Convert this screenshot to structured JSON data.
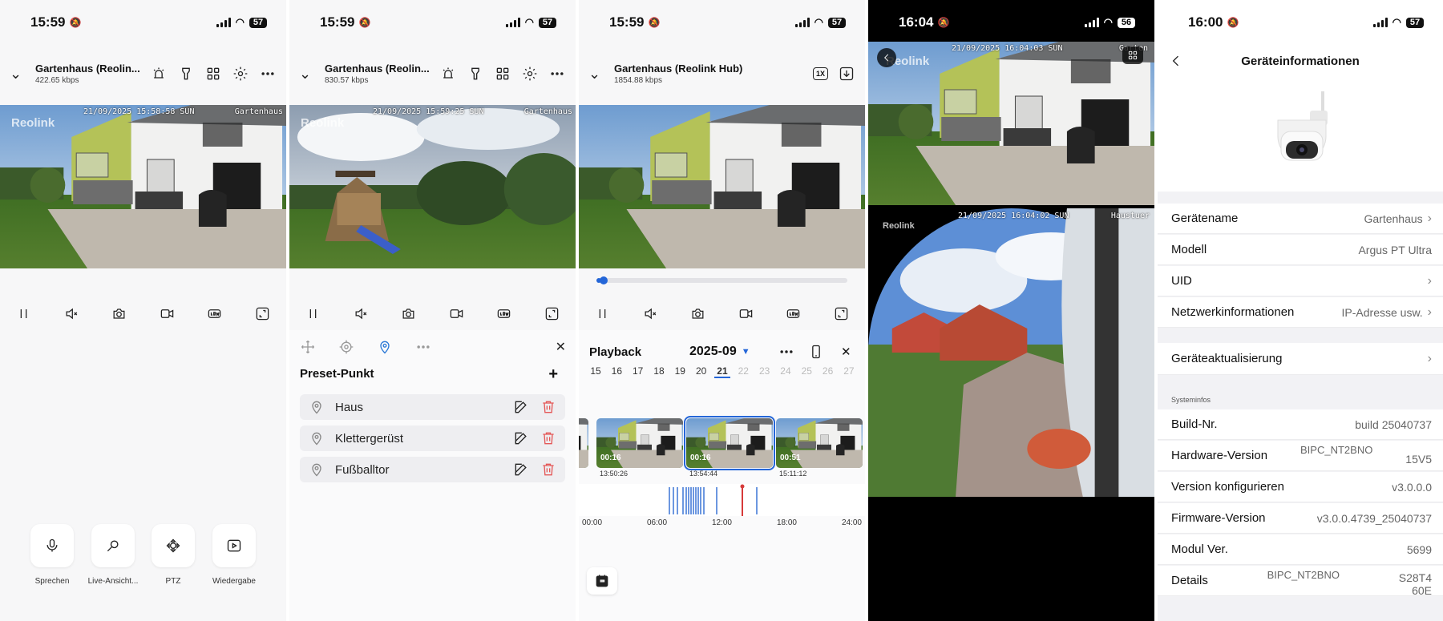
{
  "panels": [
    {
      "status": {
        "time": "15:59",
        "battery": "57"
      },
      "header": {
        "title": "Gartenhaus (Reolin...",
        "bitrate": "422.65 kbps"
      },
      "video": {
        "osd_time": "21/09/2025 15:58:58 SUN",
        "osd_name": "Gartenhaus",
        "logo": "Reolink"
      },
      "tools": [
        "Sprechen",
        "Live-Ansicht...",
        "PTZ",
        "Wiedergabe"
      ]
    },
    {
      "status": {
        "time": "15:59",
        "battery": "57"
      },
      "header": {
        "title": "Gartenhaus (Reolin...",
        "bitrate": "830.57 kbps"
      },
      "video": {
        "osd_time": "21/09/2025 15:59:25 SUN",
        "osd_name": "Gartenhaus",
        "logo": "Reolink"
      },
      "preset_title": "Preset-Punkt",
      "presets": [
        "Haus",
        "Klettergerüst",
        "Fußballtor"
      ]
    },
    {
      "status": {
        "time": "15:59",
        "battery": "57"
      },
      "header": {
        "title": "Gartenhaus (Reolink Hub)",
        "bitrate": "1854.88 kbps"
      },
      "header_badge": "1X",
      "playback": {
        "label": "Playback",
        "month": "2025-09",
        "progress": 0.02
      },
      "days": [
        "15",
        "16",
        "17",
        "18",
        "19",
        "20",
        "21",
        "22",
        "23",
        "24",
        "25",
        "26",
        "27"
      ],
      "clips": [
        {
          "duration": "00:16",
          "time": "13:50:26"
        },
        {
          "duration": "00:16",
          "time": "13:54:44"
        },
        {
          "duration": "00:51",
          "time": "15:11:12"
        }
      ],
      "timeline_ticks": [
        "00:00",
        "06:00",
        "12:00",
        "18:00",
        "24:00"
      ]
    },
    {
      "status": {
        "time": "16:04",
        "battery": "56"
      },
      "video_top": {
        "osd_time": "21/09/2025 16:04:03 SUN",
        "osd_name": "Garten",
        "logo": "Reolink"
      },
      "video_bottom": {
        "osd_time": "21/09/2025 16:04:02 SUN",
        "osd_name": "Haustuer",
        "logo": "Reolink"
      }
    },
    {
      "status": {
        "time": "16:00",
        "battery": "57"
      },
      "title": "Geräteinformationen",
      "rows": [
        {
          "label": "Gerätename",
          "value": "Gartenhaus",
          "chevron": true
        },
        {
          "label": "Modell",
          "value": "Argus PT Ultra",
          "chevron": false
        },
        {
          "label": "UID",
          "value": "",
          "chevron": true
        },
        {
          "label": "Netzwerkinformationen",
          "value": "IP-Adresse usw.",
          "chevron": true
        }
      ],
      "update_row": {
        "label": "Geräteaktualisierung"
      },
      "section_label": "Systeminfos",
      "sys_rows": [
        {
          "label": "Build-Nr.",
          "value": "build 25040737"
        },
        {
          "label": "Hardware-Version",
          "value": "BIPC_NT2BNO",
          "value2": "15V5"
        },
        {
          "label": "Version konfigurieren",
          "value": "v3.0.0.0"
        },
        {
          "label": "Firmware-Version",
          "value": "v3.0.0.4739_25040737"
        },
        {
          "label": "Modul Ver.",
          "value": "5699"
        },
        {
          "label": "Details",
          "value": "BIPC_NT2BNO",
          "value2": "S28T4",
          "value3": "60E"
        }
      ]
    }
  ]
}
